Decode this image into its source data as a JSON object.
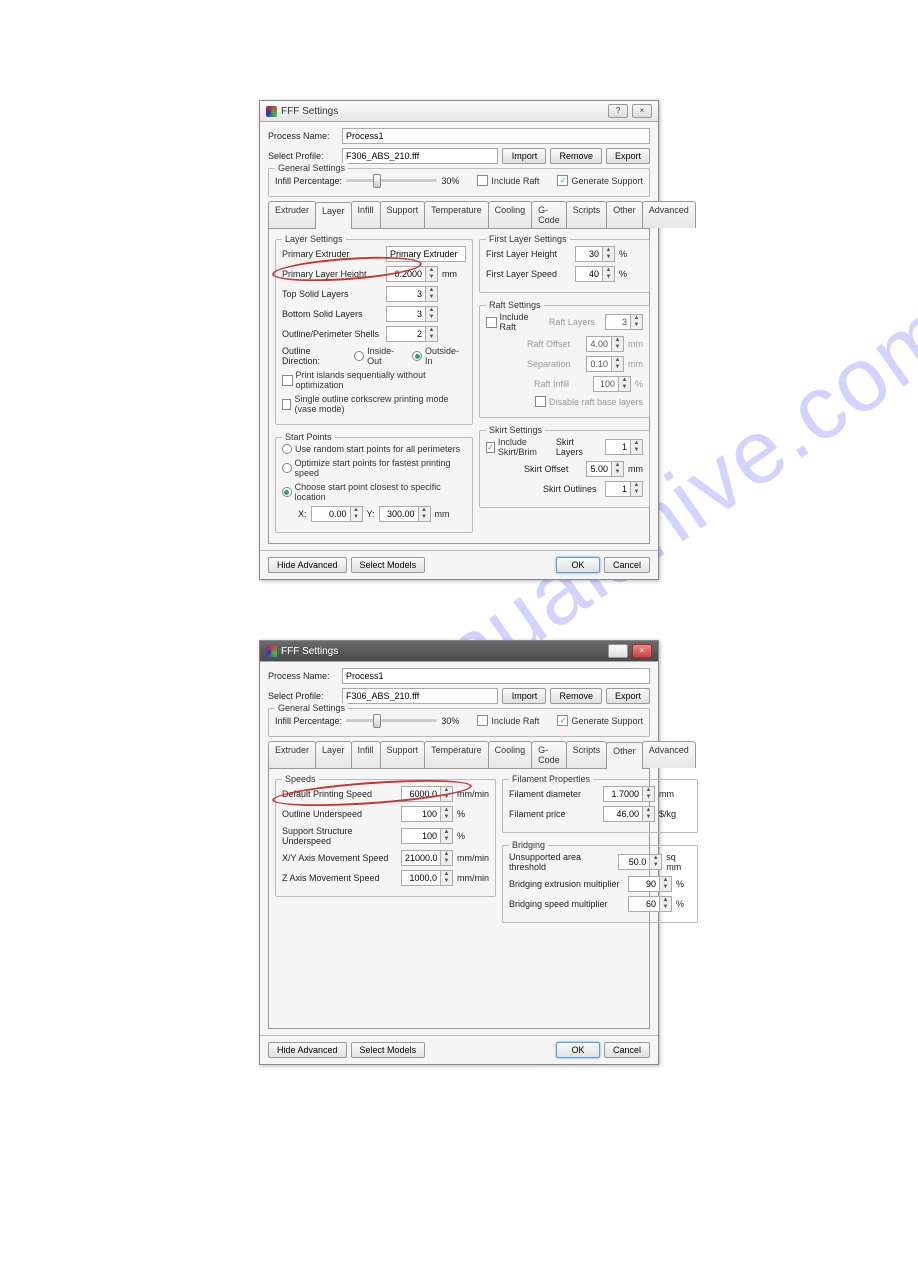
{
  "dialog1": {
    "title": "FFF Settings",
    "process_label": "Process Name:",
    "process_value": "Process1",
    "profile_label": "Select Profile:",
    "profile_value": "F306_ABS_210.fff",
    "btn_import": "Import",
    "btn_remove": "Remove",
    "btn_export": "Export",
    "general_title": "General Settings",
    "infill_label": "Infill Percentage:",
    "infill_value": "30%",
    "include_raft": "Include Raft",
    "generate_support": "Generate Support",
    "tabs": [
      "Extruder",
      "Layer",
      "Infill",
      "Support",
      "Temperature",
      "Cooling",
      "G-Code",
      "Scripts",
      "Other",
      "Advanced"
    ],
    "active_tab": "Layer",
    "layer_settings_title": "Layer Settings",
    "primary_extruder_label": "Primary Extruder",
    "primary_extruder_value": "Primary Extruder",
    "primary_layer_height_label": "Primary Layer Height",
    "primary_layer_height_value": "0.2000",
    "unit_mm": "mm",
    "top_solid_label": "Top Solid Layers",
    "top_solid_value": "3",
    "bottom_solid_label": "Bottom Solid Layers",
    "bottom_solid_value": "3",
    "outline_shells_label": "Outline/Perimeter Shells",
    "outline_shells_value": "2",
    "outline_direction_label": "Outline Direction:",
    "outline_inside_out": "Inside-Out",
    "outline_outside_in": "Outside-In",
    "print_islands": "Print islands sequentially without optimization",
    "vase_mode": "Single outline corkscrew printing mode (vase mode)",
    "start_points_title": "Start Points",
    "sp_random": "Use random start points for all perimeters",
    "sp_optimize": "Optimize start points for fastest printing speed",
    "sp_closest": "Choose start point closest to specific location",
    "sp_x": "X:",
    "sp_x_val": "0.00",
    "sp_y": "Y:",
    "sp_y_val": "300.00",
    "first_layer_title": "First Layer Settings",
    "first_layer_height_label": "First Layer Height",
    "first_layer_height_value": "30",
    "first_layer_speed_label": "First Layer Speed",
    "first_layer_speed_value": "40",
    "pct": "%",
    "raft_title": "Raft Settings",
    "raft_include": "Include Raft",
    "raft_layers_label": "Raft Layers",
    "raft_layers_value": "3",
    "raft_offset_label": "Raft Offset",
    "raft_offset_value": "4.00",
    "raft_separation_label": "Separation",
    "raft_separation_value": "0.10",
    "raft_infill_label": "Raft Infill",
    "raft_infill_value": "100",
    "raft_disable": "Disable raft base layers",
    "skirt_title": "Skirt Settings",
    "skirt_include": "Include Skirt/Brim",
    "skirt_layers_label": "Skirt Layers",
    "skirt_layers_value": "1",
    "skirt_offset_label": "Skirt Offset",
    "skirt_offset_value": "5.00",
    "skirt_outlines_label": "Skirt Outlines",
    "skirt_outlines_value": "1",
    "hide_advanced": "Hide Advanced",
    "select_models": "Select Models",
    "ok": "OK",
    "cancel": "Cancel"
  },
  "dialog2": {
    "title": "FFF Settings",
    "active_tab": "Other",
    "speeds_title": "Speeds",
    "default_speed_label": "Default Printing Speed",
    "default_speed_value": "6000.0",
    "unit_mmmin": "mm/min",
    "outline_underspeed_label": "Outline Underspeed",
    "outline_underspeed_value": "100",
    "support_underspeed_label": "Support Structure Underspeed",
    "support_underspeed_value": "100",
    "xy_speed_label": "X/Y Axis Movement Speed",
    "xy_speed_value": "21000.0",
    "z_speed_label": "Z Axis Movement Speed",
    "z_speed_value": "1000.0",
    "filament_title": "Filament Properties",
    "filament_diameter_label": "Filament diameter",
    "filament_diameter_value": "1.7000",
    "filament_price_label": "Filament price",
    "filament_price_value": "46.00",
    "unit_perkg": "$/kg",
    "bridging_title": "Bridging",
    "unsupported_label": "Unsupported area threshold",
    "unsupported_value": "50.0",
    "unit_sqmm": "sq mm",
    "bridging_ext_label": "Bridging extrusion multiplier",
    "bridging_ext_value": "90",
    "bridging_speed_label": "Bridging speed multiplier",
    "bridging_speed_value": "60"
  }
}
